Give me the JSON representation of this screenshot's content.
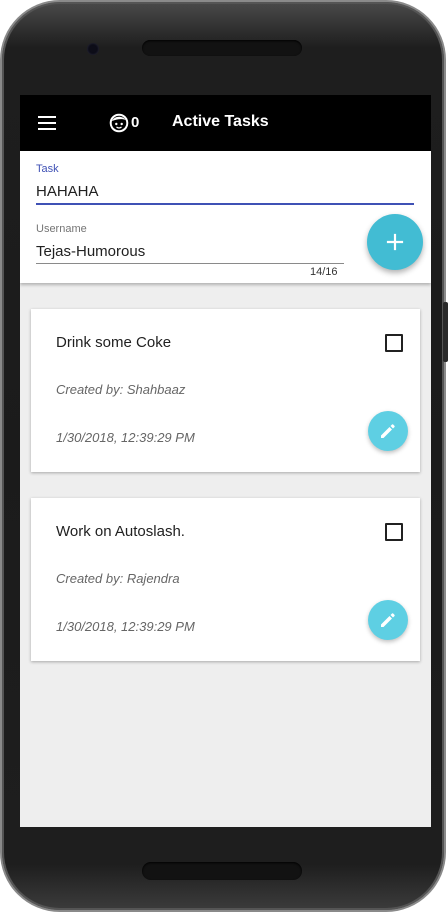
{
  "appbar": {
    "menu_icon": "hamburger-menu-icon",
    "kid_icon": "child-face-icon",
    "count": "0",
    "title": "Active Tasks"
  },
  "form": {
    "task_label": "Task",
    "task_value": "HAHAHA",
    "username_label": "Username",
    "username_value": "Tejas-Humorous",
    "char_count": "14/16",
    "add_icon": "plus-icon"
  },
  "tasks": [
    {
      "title": "Drink some Coke",
      "creator": "Created by: Shahbaaz",
      "date": "1/30/2018, 12:39:29 PM",
      "checked": false,
      "edit_icon": "pencil-icon"
    },
    {
      "title": "Work on Autoslash.",
      "creator": "Created by: Rajendra",
      "date": "1/30/2018, 12:39:29 PM",
      "checked": false,
      "edit_icon": "pencil-icon"
    }
  ],
  "colors": {
    "appbar": "#000000",
    "accent": "#3f51b5",
    "fab": "#42bcd3",
    "edit_fab": "#5ecfe3",
    "background": "#eeeeee"
  }
}
